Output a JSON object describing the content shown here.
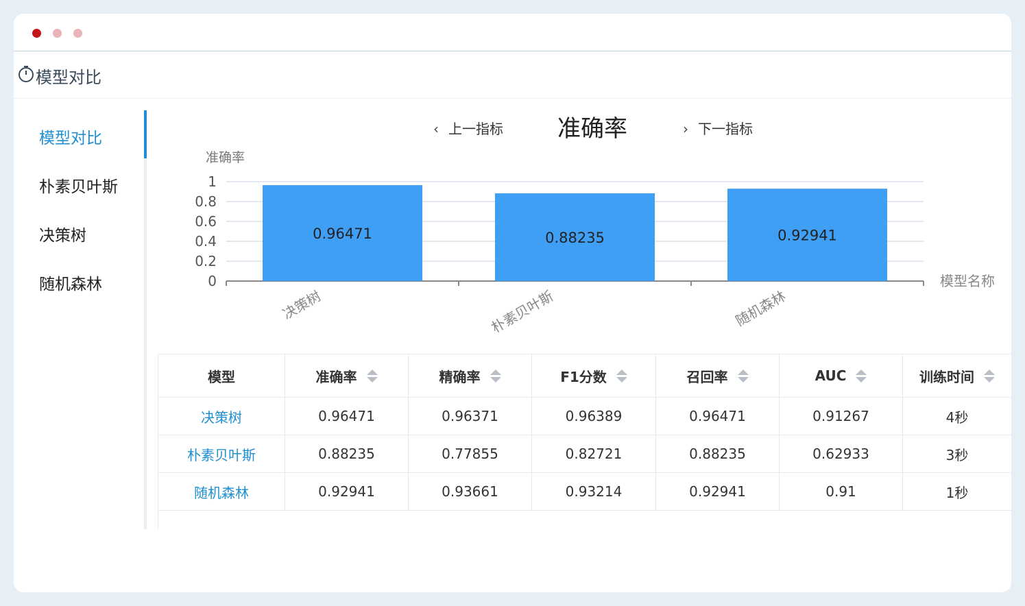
{
  "header": {
    "title": "模型对比",
    "icon": "timer-icon"
  },
  "sidebar": {
    "items": [
      {
        "label": "模型对比",
        "active": true
      },
      {
        "label": "朴素贝叶斯",
        "active": false
      },
      {
        "label": "决策树",
        "active": false
      },
      {
        "label": "随机森林",
        "active": false
      }
    ]
  },
  "metric_nav": {
    "prev_label": "上一指标",
    "current": "准确率",
    "next_label": "下一指标"
  },
  "colors": {
    "accent": "#1f8fd0",
    "bar": "#3f9ff5"
  },
  "chart_data": {
    "type": "bar",
    "title": "",
    "ylabel": "准确率",
    "xlabel": "模型名称",
    "categories": [
      "决策树",
      "朴素贝叶斯",
      "随机森林"
    ],
    "values": [
      0.96471,
      0.88235,
      0.92941
    ],
    "value_labels": [
      "0.96471",
      "0.88235",
      "0.92941"
    ],
    "ylim": [
      0,
      1
    ],
    "yticks": [
      "0",
      "0.2",
      "0.4",
      "0.6",
      "0.8",
      "1"
    ],
    "grid": true
  },
  "table": {
    "columns": [
      "模型",
      "准确率",
      "精确率",
      "F1分数",
      "召回率",
      "AUC",
      "训练时间"
    ],
    "rows": [
      [
        "决策树",
        "0.96471",
        "0.96371",
        "0.96389",
        "0.96471",
        "0.91267",
        "4秒"
      ],
      [
        "朴素贝叶斯",
        "0.88235",
        "0.77855",
        "0.82721",
        "0.88235",
        "0.62933",
        "3秒"
      ],
      [
        "随机森林",
        "0.92941",
        "0.93661",
        "0.93214",
        "0.92941",
        "0.91",
        "1秒"
      ]
    ]
  }
}
